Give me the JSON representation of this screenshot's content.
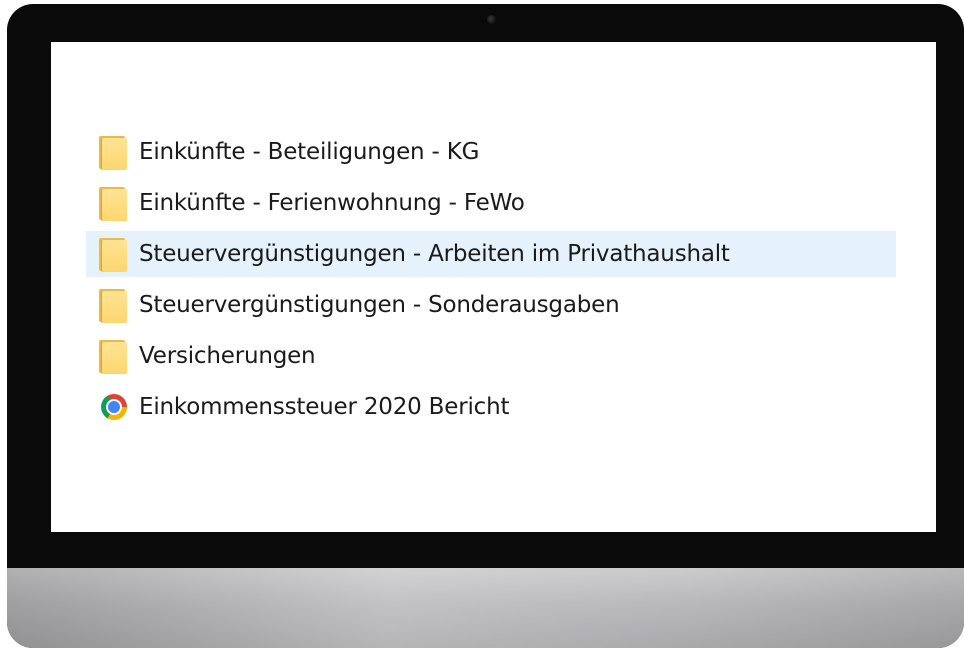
{
  "window": {
    "items": [
      {
        "label": "Einkünfte - Beteiligungen - KG",
        "icon": "folder-icon",
        "selected": false
      },
      {
        "label": "Einkünfte - Ferienwohnung - FeWo",
        "icon": "folder-icon",
        "selected": false
      },
      {
        "label": "Steuervergünstigungen - Arbeiten im Privathaushalt",
        "icon": "folder-icon",
        "selected": true
      },
      {
        "label": "Steuervergünstigungen - Sonderausgaben",
        "icon": "folder-icon",
        "selected": false
      },
      {
        "label": "Versicherungen",
        "icon": "folder-icon",
        "selected": false
      },
      {
        "label": "Einkommenssteuer 2020 Bericht",
        "icon": "chrome-icon",
        "selected": false
      }
    ]
  },
  "colors": {
    "selection_background": "#e5f1fb",
    "folder_yellow": "#fcd66f",
    "monitor_bezel": "#0a0a0a",
    "monitor_chin": "#b5b5b8"
  }
}
